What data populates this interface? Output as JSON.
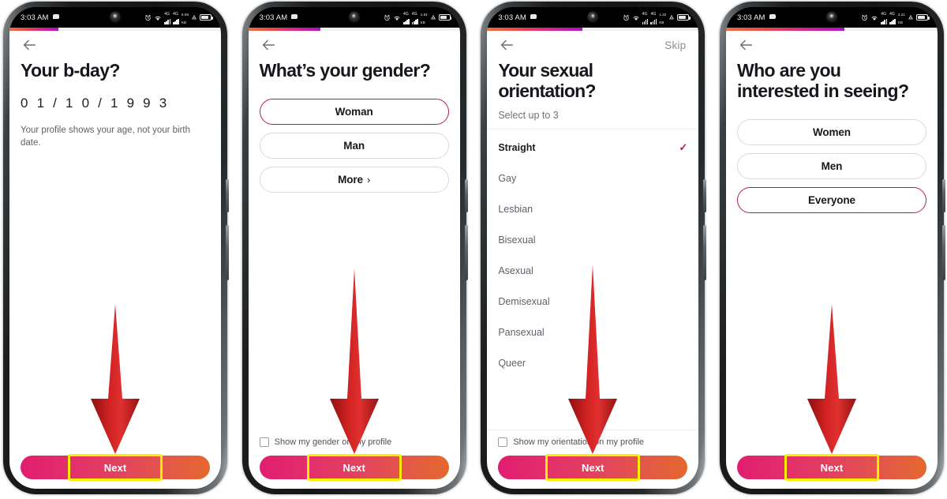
{
  "status_bar": {
    "time": "3:03 AM",
    "icons": [
      "message-icon",
      "front-camera",
      "alarm-icon",
      "wifi-icon",
      "signal-4g-sim1",
      "signal-4g-sim2",
      "data-speed-icon",
      "vibrate-icon",
      "battery-icon"
    ],
    "network_label": "4G",
    "battery_level": "78"
  },
  "theme": {
    "accent_selected_border": "#b51f44",
    "accent_check": "#b51f44",
    "next_gradient_from": "#e11d70",
    "next_gradient_to": "#e4682f",
    "progress_gradient_from": "#f06c3e",
    "progress_gradient_to": "#b111c9",
    "highlight_box": "#ffee00",
    "arrow_color": "#cc1111",
    "title_color": "#16181c",
    "muted_text": "#5d6168"
  },
  "screens": [
    {
      "id": "birthday",
      "progress_percent": 23,
      "back_label": "back-arrow",
      "skip_label": "",
      "title": "Your b-day?",
      "birthday_value": "0 1  / 1  0  / 1  9  9  3",
      "helper_text": "Your profile shows your age, not your birth date.",
      "next_label": "Next",
      "highlighted": true
    },
    {
      "id": "gender",
      "progress_percent": 34,
      "back_label": "back-arrow",
      "skip_label": "",
      "title": "What’s your gender?",
      "options": [
        {
          "label": "Woman",
          "selected": true,
          "chevron": ""
        },
        {
          "label": "Man",
          "selected": false,
          "chevron": ""
        },
        {
          "label": "More",
          "selected": false,
          "chevron": "›"
        }
      ],
      "checkbox_label": "Show my gender on my profile",
      "checkbox_checked": false,
      "next_label": "Next",
      "highlighted": true
    },
    {
      "id": "orientation",
      "progress_percent": 45,
      "back_label": "back-arrow",
      "skip_label": "Skip",
      "title": "Your sexual orientation?",
      "subtitle": "Select up to 3",
      "list": [
        {
          "label": "Straight",
          "selected": true
        },
        {
          "label": "Gay",
          "selected": false
        },
        {
          "label": "Lesbian",
          "selected": false
        },
        {
          "label": "Bisexual",
          "selected": false
        },
        {
          "label": "Asexual",
          "selected": false
        },
        {
          "label": "Demisexual",
          "selected": false
        },
        {
          "label": "Pansexual",
          "selected": false
        },
        {
          "label": "Queer",
          "selected": false
        }
      ],
      "check_glyph": "✓",
      "checkbox_label": "Show my orientation on my profile",
      "checkbox_checked": false,
      "next_label": "Next",
      "highlighted": true
    },
    {
      "id": "interested-in",
      "progress_percent": 56,
      "back_label": "back-arrow",
      "skip_label": "",
      "title": "Who are you interested in seeing?",
      "options": [
        {
          "label": "Women",
          "selected": false,
          "chevron": ""
        },
        {
          "label": "Men",
          "selected": false,
          "chevron": ""
        },
        {
          "label": "Everyone",
          "selected": true,
          "chevron": ""
        }
      ],
      "next_label": "Next",
      "highlighted": true
    }
  ]
}
